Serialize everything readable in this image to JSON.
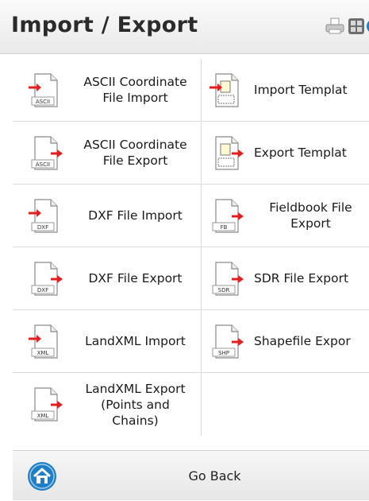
{
  "window": {
    "title": "Import / Export"
  },
  "toolbar": {
    "printer_icon": "printer-icon",
    "grid_icon": "grid-icon",
    "help_icon": "help-icon"
  },
  "colors": {
    "accent": "#1e7fc6",
    "arrow": "#e02020",
    "icon_outline": "#7a7a7a"
  },
  "menu": {
    "left": [
      {
        "label": "ASCII Coordinate\nFile Import",
        "badge": "ASCII",
        "direction": "import"
      },
      {
        "label": "ASCII Coordinate\nFile Export",
        "badge": "ASCII",
        "direction": "export"
      },
      {
        "label": "DXF File Import",
        "badge": "DXF",
        "direction": "import"
      },
      {
        "label": "DXF File Export",
        "badge": "DXF",
        "direction": "export"
      },
      {
        "label": "LandXML Import",
        "badge": "XML",
        "direction": "import"
      },
      {
        "label": "LandXML Export\n(Points and\nChains)",
        "badge": "XML",
        "direction": "export"
      }
    ],
    "right": [
      {
        "label": "Import Templat",
        "badge": "",
        "direction": "import"
      },
      {
        "label": "Export Templat",
        "badge": "",
        "direction": "export"
      },
      {
        "label": "Fieldbook File\nExport",
        "badge": "FB",
        "direction": "export"
      },
      {
        "label": "SDR File Export",
        "badge": "SDR",
        "direction": "export"
      },
      {
        "label": "Shapefile Expor",
        "badge": "SHP",
        "direction": "export"
      }
    ]
  },
  "footer": {
    "go_back_label": "Go Back",
    "icon": "home-icon"
  }
}
